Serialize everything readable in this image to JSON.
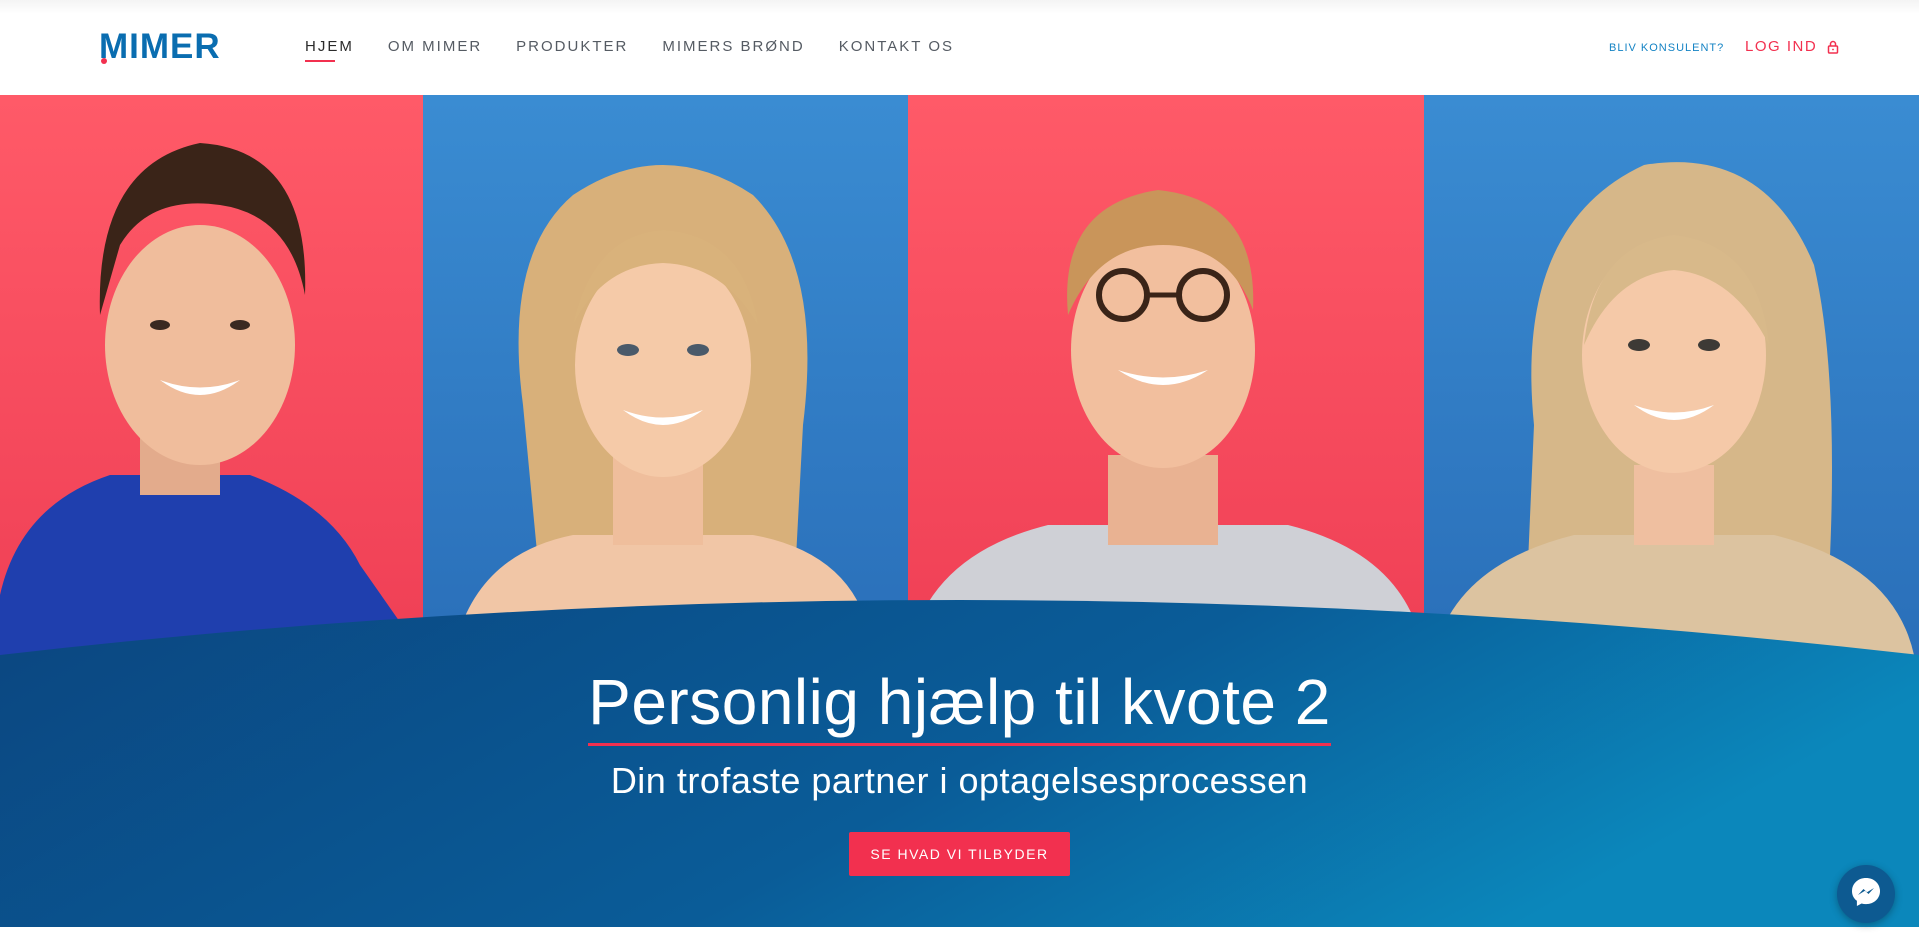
{
  "header": {
    "logo": "MIMER",
    "nav": [
      {
        "label": "HJEM",
        "active": true
      },
      {
        "label": "OM MIMER"
      },
      {
        "label": "PRODUKTER"
      },
      {
        "label": "MIMERS BRØND"
      },
      {
        "label": "KONTAKT OS"
      }
    ],
    "consult_link": "BLIV KONSULENT?",
    "login_label": "LOG IND",
    "login_icon": "lock-icon"
  },
  "hero": {
    "title": "Personlig hjælp til kvote 2",
    "subtitle": "Din trofaste partner i optagelsesprocessen",
    "cta": "SE HVAD VI TILBYDER",
    "photo_backgrounds": [
      "red",
      "blue",
      "red",
      "blue"
    ]
  },
  "chat_widget": {
    "icon": "messenger-icon"
  },
  "colors": {
    "brand_blue": "#0a6db0",
    "accent_red": "#f2304f",
    "hero_blue_dark": "#0b4680",
    "hero_blue_light": "#0b83b8"
  }
}
